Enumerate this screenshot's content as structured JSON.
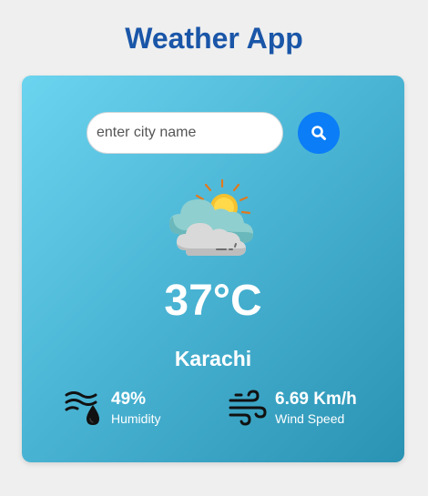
{
  "app": {
    "title": "Weather App"
  },
  "search": {
    "placeholder": "enter city name",
    "value": "",
    "button_icon": "search-icon"
  },
  "weather": {
    "icon": "partly-cloudy-icon",
    "temperature": "37°C",
    "city": "Karachi"
  },
  "details": {
    "humidity": {
      "icon": "humidity-icon",
      "value": "49%",
      "label": "Humidity"
    },
    "wind": {
      "icon": "wind-icon",
      "value": "6.69 Km/h",
      "label": "Wind Speed"
    }
  },
  "colors": {
    "title": "#1a56a8",
    "search_button": "#0b7df6",
    "card_gradient_start": "#6bd4ef",
    "card_gradient_end": "#2a92b3"
  }
}
